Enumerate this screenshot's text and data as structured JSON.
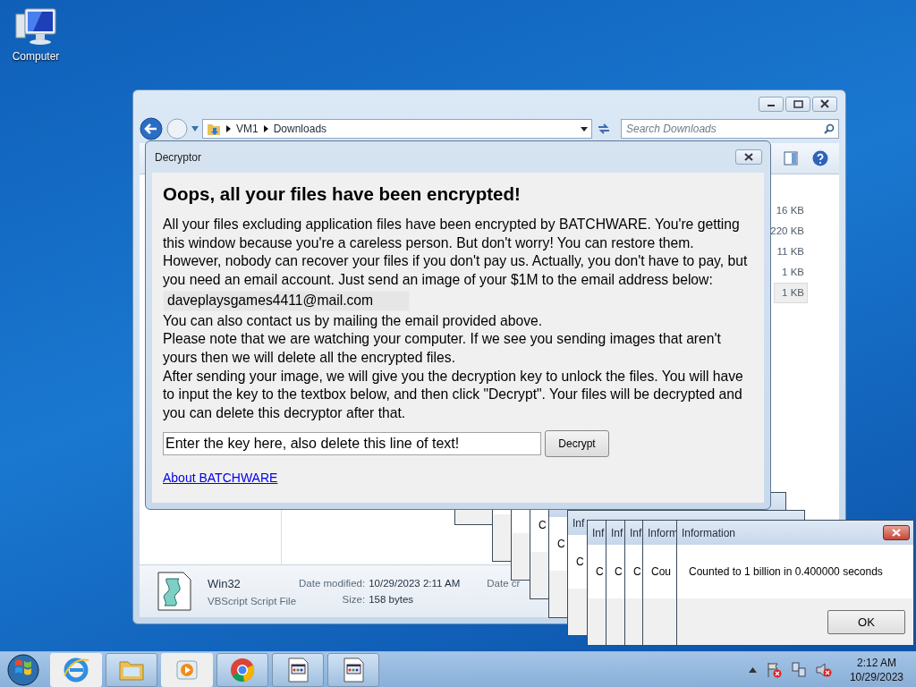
{
  "desktop_icons": [
    {
      "label": "Computer"
    }
  ],
  "explorer": {
    "path": [
      "VM1",
      "Downloads"
    ],
    "search": {
      "placeholder": "Search Downloads"
    },
    "sizes": [
      {
        "text": "16 KB",
        "selected": false
      },
      {
        "text": "220 KB",
        "selected": false
      },
      {
        "text": "11 KB",
        "selected": false
      },
      {
        "text": "1 KB",
        "selected": false
      },
      {
        "text": "1 KB",
        "selected": true
      }
    ],
    "details": {
      "name": "Win32",
      "type": "VBScript Script File",
      "modified_label": "Date modified:",
      "modified": "10/29/2023 2:11 AM",
      "size_label": "Size:",
      "size": "158 bytes",
      "created_label": "Date cr"
    }
  },
  "decryptor": {
    "title": "Decryptor",
    "heading": "Oops, all your files have been encrypted!",
    "intro": "All your files excluding application files have been encrypted by BATCHWARE. You're getting this window because you're a careless person. But don't worry! You can restore them. However, nobody can recover your files if you don't pay us. Actually, you don't have to pay, but you need an email account. Just send an image of your $1M to the email address below:",
    "email": "daveplaysgames4411@mail.com",
    "notes": [
      "You can also contact us by mailing the email provided above.",
      "Please note that we are watching your computer. If we see you sending images that aren't yours then we will delete all the encrypted files.",
      "After sending your image, we will give you the decryption key to unlock the files. You will have to input the key to the textbox below, and then click \"Decrypt\". Your files will be decrypted and you can delete this decryptor after that."
    ],
    "key_field": {
      "value": "Enter the key here, also delete this line of text!"
    },
    "decrypt_button": "Decrypt",
    "link": "About BATCHWARE"
  },
  "info_windows": [
    {
      "kind": "stacked"
    },
    {
      "kind": "stacked"
    },
    {
      "kind": "stacked"
    },
    {
      "kind": "stacked",
      "message": "C"
    },
    {
      "kind": "stacked",
      "message": "C"
    },
    {
      "kind": "stacked",
      "title": "Inf",
      "message": "C"
    },
    {
      "kind": "stacked",
      "title": "Inf",
      "message": "C"
    },
    {
      "kind": "stacked",
      "title": "Inf",
      "message": "C"
    },
    {
      "kind": "stacked",
      "title": "Inf",
      "message": "C"
    },
    {
      "kind": "stacked",
      "title": "Inform",
      "message": "Cou"
    },
    {
      "kind": "dialog",
      "title": "Information",
      "message": "Counted to 1 billion in 0.400000 seconds",
      "button": "OK"
    }
  ],
  "taskbar": {
    "apps": [
      {
        "kind": "browser"
      },
      {
        "kind": "folder"
      },
      {
        "kind": "media"
      },
      {
        "kind": "chrome"
      },
      {
        "kind": "program"
      },
      {
        "kind": "program"
      }
    ],
    "clock": {
      "time": "2:12 AM",
      "date": "10/29/2023"
    }
  }
}
